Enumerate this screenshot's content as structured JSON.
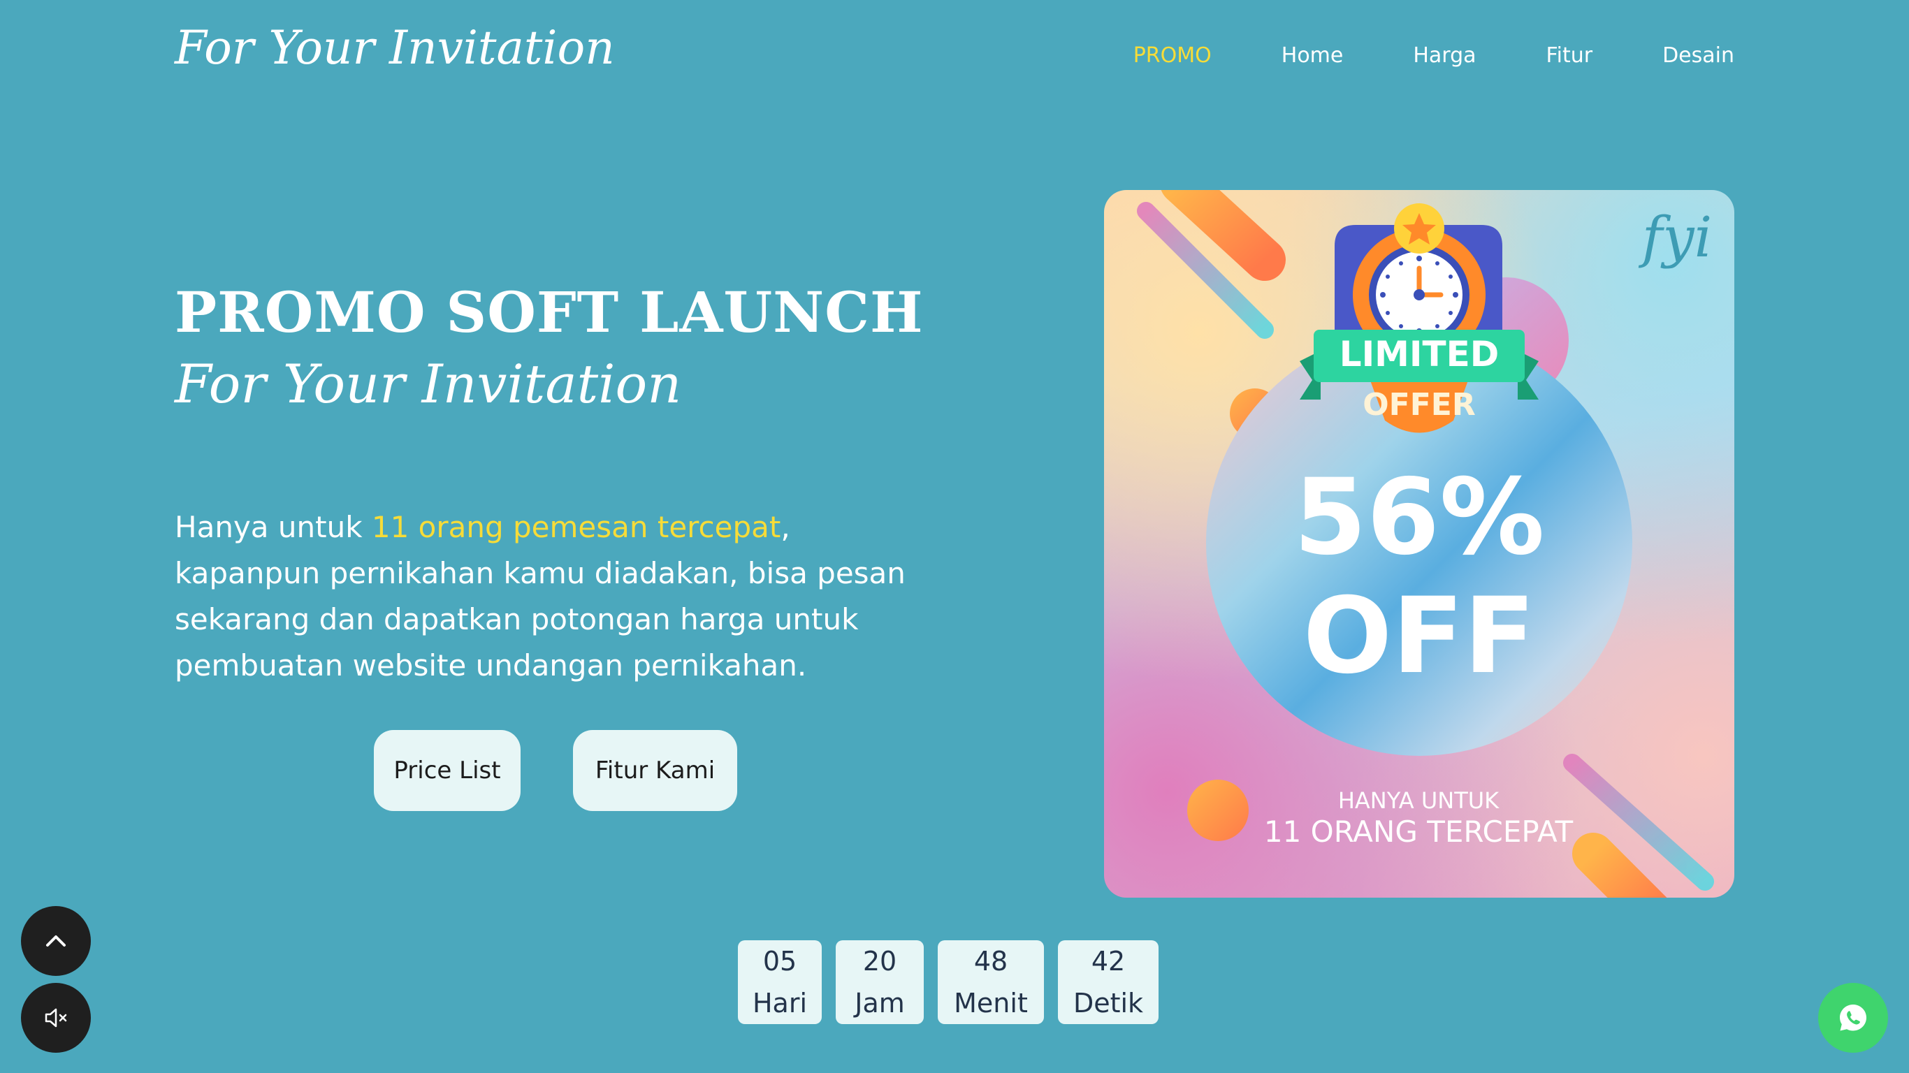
{
  "header": {
    "brand": "For Your Invitation",
    "nav": [
      {
        "label": "PROMO",
        "active": true
      },
      {
        "label": "Home",
        "active": false
      },
      {
        "label": "Harga",
        "active": false
      },
      {
        "label": "Fitur",
        "active": false
      },
      {
        "label": "Desain",
        "active": false
      }
    ]
  },
  "hero": {
    "title": "PROMO SOFT LAUNCH",
    "subtitle": "For Your Invitation",
    "desc_prefix": "Hanya untuk ",
    "desc_highlight": "11 orang pemesan tercepat",
    "desc_suffix": ", kapanpun pernikahan kamu diadakan, bisa pesan sekarang dan dapatkan potongan harga untuk pembuatan website undangan pernikahan.",
    "buttons": {
      "price": "Price List",
      "features": "Fitur Kami"
    }
  },
  "promo_card": {
    "logo": "fyi",
    "badge_line1": "LIMITED",
    "badge_line2": "OFFER",
    "discount": "56%",
    "off": "OFF",
    "footer_line1": "HANYA UNTUK",
    "footer_line2": "11 ORANG TERCEPAT"
  },
  "countdown": {
    "days": {
      "value": "05",
      "label": "Hari"
    },
    "hours": {
      "value": "20",
      "label": "Jam"
    },
    "minutes": {
      "value": "48",
      "label": "Menit"
    },
    "seconds": {
      "value": "42",
      "label": "Detik"
    }
  },
  "icons": {
    "scroll_top": "chevron-up-icon",
    "mute": "speaker-mute-icon",
    "whatsapp": "whatsapp-icon"
  },
  "colors": {
    "background": "#4ba8bd",
    "highlight": "#f7dc38",
    "button_bg": "#e7f6f6",
    "whatsapp": "#3fd46d"
  }
}
